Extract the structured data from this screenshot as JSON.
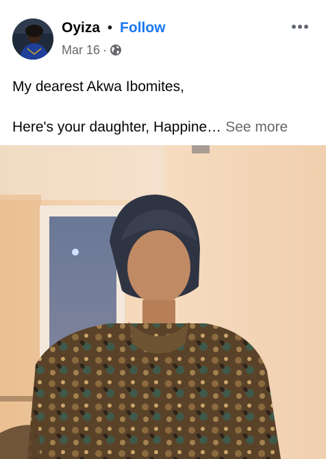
{
  "post": {
    "author": "Oyiza",
    "separator": "•",
    "follow_label": "Follow",
    "date": "Mar 16",
    "meta_sep": "·",
    "privacy_icon": "globe-icon",
    "more_icon": "more-horizontal-icon",
    "caption_line1": "My dearest Akwa Ibomites,",
    "caption_line2": "Here's your daughter, Happine…",
    "see_more_label": "See more"
  },
  "colors": {
    "accent": "#1877f2",
    "secondary_text": "#65676b",
    "primary_text": "#050505"
  }
}
